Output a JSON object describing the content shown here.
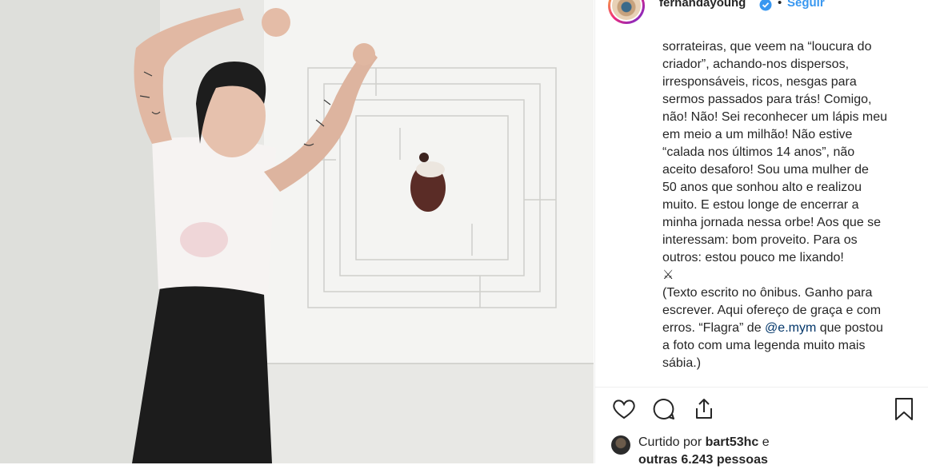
{
  "post": {
    "username": "fernandayoung",
    "dot": "•",
    "follow_label": "Seguir",
    "more_label": "•••",
    "photo_alt": "",
    "caption_lines": [
      "sorrateiras, que veem na “loucura do",
      "criador”, achando-nos dispersos,",
      "irresponsáveis, ricos, nesgas para",
      "sermos passados para trás! Comigo,",
      "não! Não! Sei reconhecer um lápis meu",
      "em meio a um milhão! Não estive",
      "“calada nos últimos 14 anos”, não",
      "aceito desaforo! Sou uma mulher de",
      "50 anos que sonhou alto e realizou",
      "muito. E estou longe de encerrar a",
      "minha jornada nessa orbe! Aos que se",
      "interessam: bom proveito. Para os",
      "outros: estou pouco me lixando!",
      "⚔",
      "(Texto escrito no ônibus. Ganho para",
      "escrever. Aqui ofereço de graça e com",
      "erros. “Flagra” de"
    ],
    "mention": "@e.mym",
    "caption_after_mention": " que postou",
    "caption_tail_lines": [
      "a foto com uma legenda muito mais",
      "sábia.)"
    ],
    "likes": {
      "prefix": "Curtido por ",
      "user": "bart53hc",
      "suffix": " e",
      "others": "outras 6.243 pessoas"
    },
    "icons": {
      "like": "heart-icon",
      "comment": "comment-icon",
      "share": "share-icon",
      "save": "bookmark-icon",
      "verified": "verified-badge-icon"
    },
    "colors": {
      "link": "#3897f0",
      "mention": "#003569",
      "text": "#262626"
    }
  }
}
